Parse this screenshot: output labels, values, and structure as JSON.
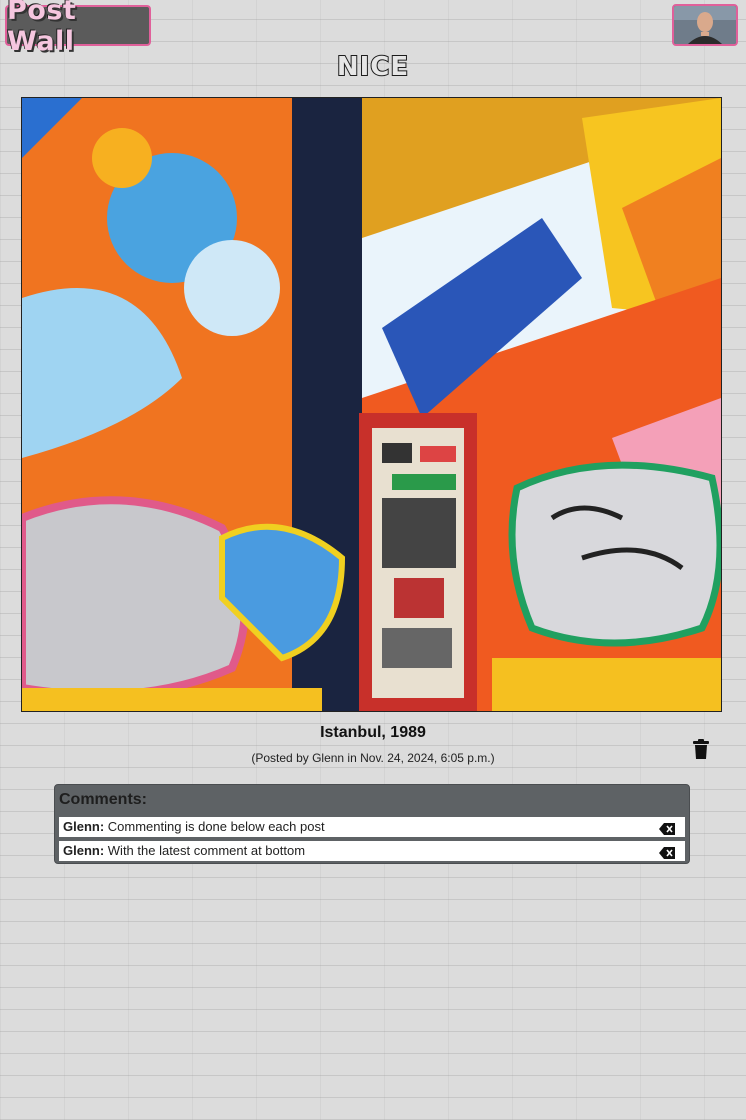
{
  "header": {
    "logo_text": "Post Wall",
    "avatar_icon": "user-avatar"
  },
  "post": {
    "title": "NICE",
    "caption": "Istanbul, 1989",
    "meta": "(Posted by Glenn in Nov. 24, 2024, 6:05 p.m.)",
    "image_icon": "graffiti-wall-photo",
    "delete_icon": "trash-icon"
  },
  "comments": {
    "header": "Comments:",
    "items": [
      {
        "author": "Glenn:",
        "text": " Commenting is done below each post"
      },
      {
        "author": "Glenn:",
        "text": " With the latest comment at bottom"
      }
    ],
    "delete_icon": "backspace-icon"
  },
  "colors": {
    "accent_pink": "#e0609a",
    "panel_gray": "#5e6265"
  }
}
